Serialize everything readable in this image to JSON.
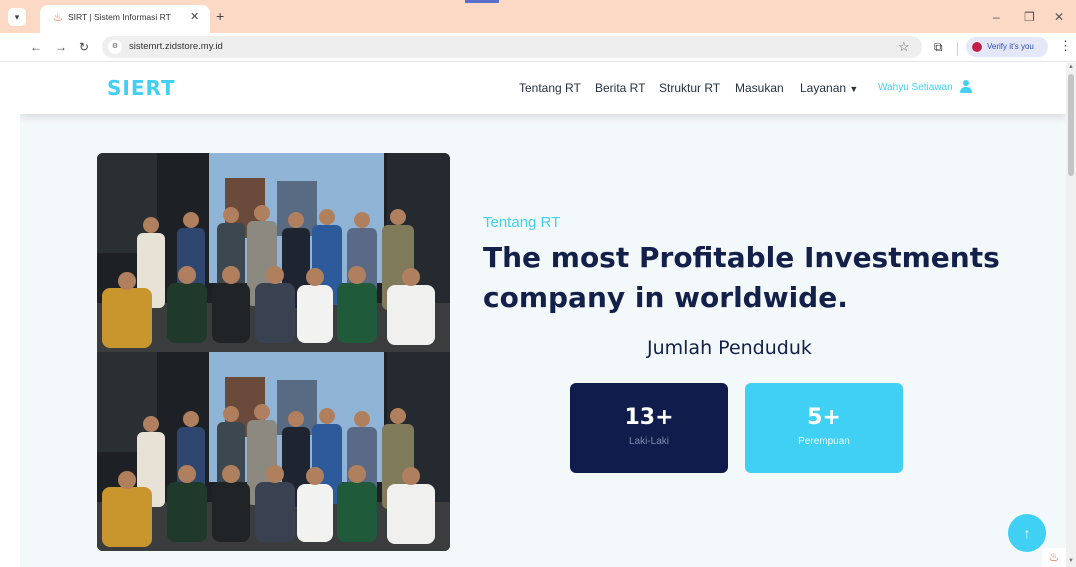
{
  "browser": {
    "tab_title": "SIRT | Sistem Informasi RT",
    "url": "sistemrt.zidstore.my.id",
    "profile_chip": "Verify it's you",
    "icons": {
      "tab_search": "chevron-down-icon",
      "favicon": "flame-icon",
      "close_tab": "close-icon",
      "new_tab": "plus-icon",
      "back": "arrow-left-icon",
      "forward": "arrow-right-icon",
      "reload": "reload-icon",
      "site_info": "tune-icon",
      "bookmark": "star-icon",
      "extensions": "puzzle-icon",
      "menu": "kebab-icon",
      "minimize": "minimize-icon",
      "restore": "restore-icon",
      "close_window": "close-icon"
    }
  },
  "site": {
    "logo": "SIERT",
    "nav": [
      {
        "label": "Tentang RT"
      },
      {
        "label": "Berita RT"
      },
      {
        "label": "Struktur RT"
      },
      {
        "label": "Masukan"
      },
      {
        "label": "Layanan"
      }
    ],
    "user_name": "Wahyu Setiawan",
    "hero": {
      "eyebrow": "Tentang RT",
      "headline": "The most Profitable Investments company in worldwide.",
      "population_title": "Jumlah Penduduk",
      "stats": [
        {
          "value": "13+",
          "label": "Laki-Laki"
        },
        {
          "value": "5+",
          "label": "Perempuan"
        }
      ]
    }
  },
  "colors": {
    "brand": "#3fd0f3",
    "navy": "#101d4c",
    "tabbar": "#fbd9c4",
    "page_bg": "#f3f8fa"
  }
}
